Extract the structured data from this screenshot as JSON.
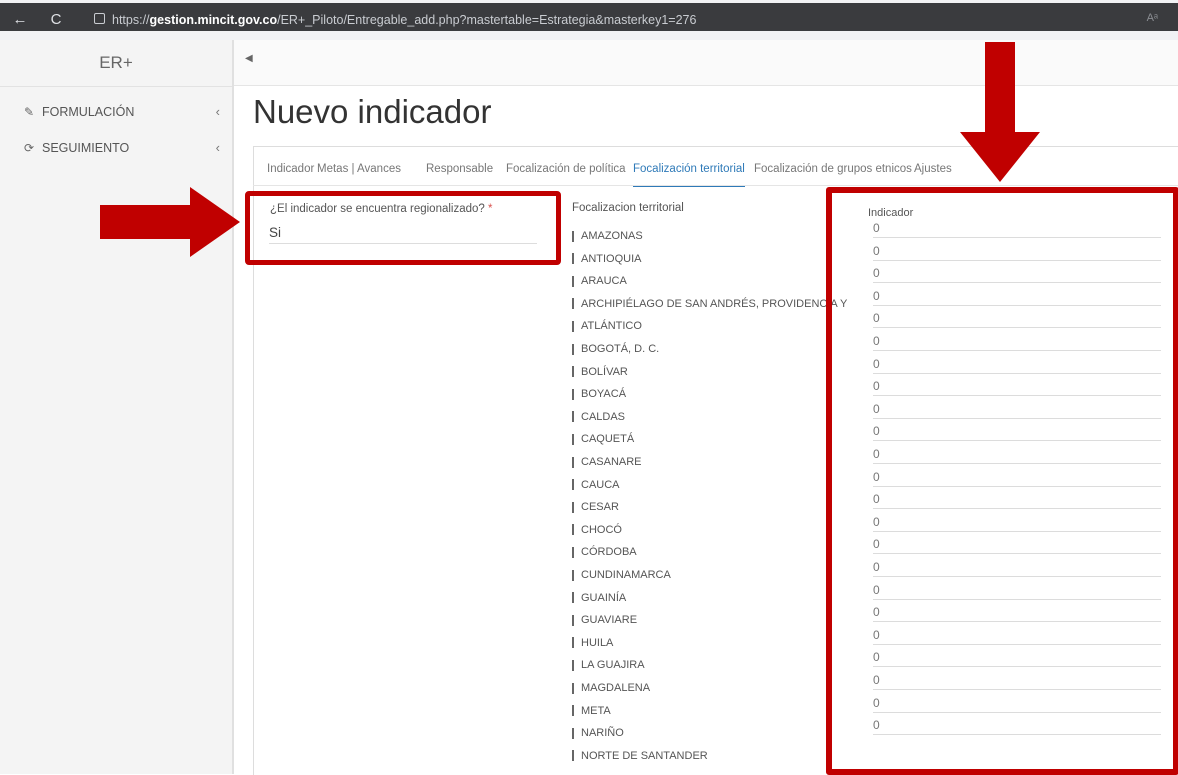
{
  "browser": {
    "url_prefix": "https://",
    "url_domain": "gestion.mincit.gov.co",
    "url_path": "/ER+_Piloto/Entregable_add.php?mastertable=Estrategia&masterkey1=276",
    "back_glyph": "←",
    "reload_glyph": "C",
    "reader_glyph": "Aᵃ"
  },
  "sidebar": {
    "brand": "ER+",
    "items": [
      {
        "label": "FORMULACIÓN",
        "icon": "edit-icon",
        "glyph": "✎"
      },
      {
        "label": "SEGUIMIENTO",
        "icon": "sync-icon",
        "glyph": "⟳"
      }
    ],
    "chevron": "‹"
  },
  "toolbar": {
    "collapse_glyph": "◀"
  },
  "page": {
    "title": "Nuevo indicador"
  },
  "tabs": [
    {
      "label": "Indicador"
    },
    {
      "label": "Metas | Avances"
    },
    {
      "label": "Responsable"
    },
    {
      "label": "Focalización de política"
    },
    {
      "label": "Focalización territorial",
      "active": true
    },
    {
      "label": "Focalización de grupos etnicos"
    },
    {
      "label": "Ajustes"
    }
  ],
  "form": {
    "regionalized_label": "¿El indicador se encuentra regionalizado?",
    "required_mark": "*",
    "regionalized_value": "Si"
  },
  "territorial": {
    "heading": "Focalizacion territorial",
    "indicator_heading": "Indicador",
    "rows": [
      {
        "name": "AMAZONAS",
        "value": "0"
      },
      {
        "name": "ANTIOQUIA",
        "value": "0"
      },
      {
        "name": "ARAUCA",
        "value": "0"
      },
      {
        "name": "ARCHIPIÉLAGO DE SAN ANDRÉS, PROVIDENCIA Y",
        "value": "0"
      },
      {
        "name": "ATLÁNTICO",
        "value": "0"
      },
      {
        "name": "BOGOTÁ, D. C.",
        "value": "0"
      },
      {
        "name": "BOLÍVAR",
        "value": "0"
      },
      {
        "name": "BOYACÁ",
        "value": "0"
      },
      {
        "name": "CALDAS",
        "value": "0"
      },
      {
        "name": "CAQUETÁ",
        "value": "0"
      },
      {
        "name": "CASANARE",
        "value": "0"
      },
      {
        "name": "CAUCA",
        "value": "0"
      },
      {
        "name": "CESAR",
        "value": "0"
      },
      {
        "name": "CHOCÓ",
        "value": "0"
      },
      {
        "name": "CÓRDOBA",
        "value": "0"
      },
      {
        "name": "CUNDINAMARCA",
        "value": "0"
      },
      {
        "name": "GUAINÍA",
        "value": "0"
      },
      {
        "name": "GUAVIARE",
        "value": "0"
      },
      {
        "name": "HUILA",
        "value": "0"
      },
      {
        "name": "LA GUAJIRA",
        "value": "0"
      },
      {
        "name": "MAGDALENA",
        "value": "0"
      },
      {
        "name": "META",
        "value": "0"
      },
      {
        "name": "NARIÑO",
        "value": "0"
      },
      {
        "name": "NORTE DE SANTANDER",
        "value": ""
      }
    ]
  },
  "colors": {
    "highlight": "#c00000",
    "active_tab": "#2f7ab8"
  }
}
